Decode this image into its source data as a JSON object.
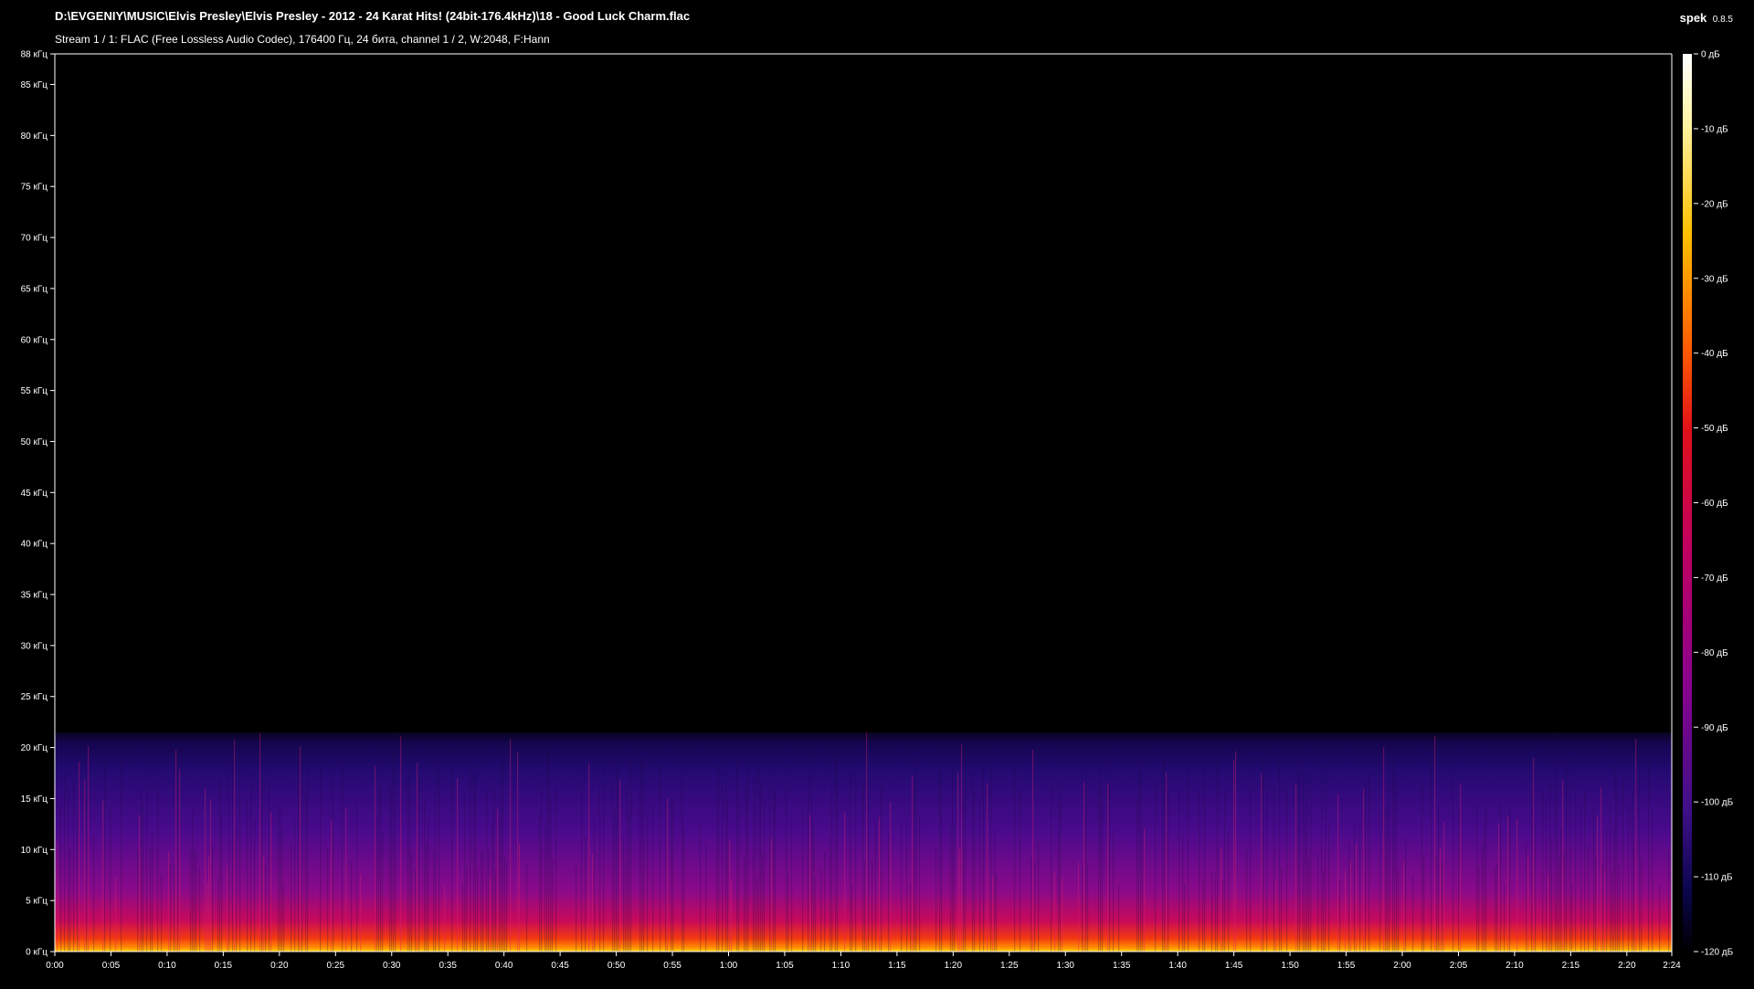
{
  "header": {
    "title": "D:\\EVGENIY\\MUSIC\\Elvis Presley\\Elvis Presley - 2012 - 24 Karat Hits! (24bit-176.4kHz)\\18 - Good Luck Charm.flac",
    "subtitle": "Stream 1 / 1: FLAC (Free Lossless Audio Codec), 176400 Гц, 24 бита, channel 1 / 2, W:2048, F:Hann",
    "app_name": "spek",
    "app_version": "0.8.5"
  },
  "colors": {
    "background": "#000000",
    "axis": "#ffffff",
    "palette": [
      "#000000",
      "#0b0030",
      "#2a0a6e",
      "#6a0a8a",
      "#a0086e",
      "#d8102e",
      "#fa4a00",
      "#ffa000",
      "#ffe040",
      "#ffffe8"
    ]
  },
  "chart_data": {
    "type": "heatmap",
    "title": "",
    "xlabel": "",
    "ylabel": "",
    "x_range_seconds": [
      0,
      144
    ],
    "y_range_khz": [
      0,
      88
    ],
    "content_cutoff_khz": 21.5,
    "colorbar_range_db": [
      -120,
      0
    ],
    "x_tick_labels": [
      "0:00",
      "0:05",
      "0:10",
      "0:15",
      "0:20",
      "0:25",
      "0:30",
      "0:35",
      "0:40",
      "0:45",
      "0:50",
      "0:55",
      "1:00",
      "1:05",
      "1:10",
      "1:15",
      "1:20",
      "1:25",
      "1:30",
      "1:35",
      "1:40",
      "1:45",
      "1:50",
      "1:55",
      "2:00",
      "2:05",
      "2:10",
      "2:15",
      "2:20",
      "2:24"
    ],
    "y_tick_labels": [
      "0 кГц",
      "5 кГц",
      "10 кГц",
      "15 кГц",
      "20 кГц",
      "25 кГц",
      "30 кГц",
      "35 кГц",
      "40 кГц",
      "45 кГц",
      "50 кГц",
      "55 кГц",
      "60 кГц",
      "65 кГц",
      "70 кГц",
      "75 кГц",
      "80 кГц",
      "85 кГц",
      "88 кГц"
    ],
    "colorbar_tick_labels": [
      "0 дБ",
      "-10 дБ",
      "-20 дБ",
      "-30 дБ",
      "-40 дБ",
      "-50 дБ",
      "-60 дБ",
      "-70 дБ",
      "-80 дБ",
      "-90 дБ",
      "-100 дБ",
      "-110 дБ",
      "-120 дБ"
    ]
  }
}
